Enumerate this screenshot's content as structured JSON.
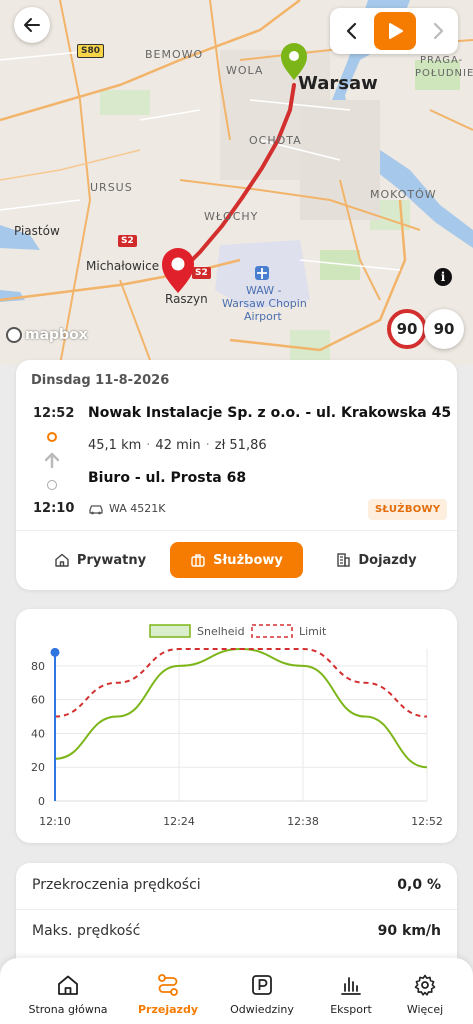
{
  "map": {
    "labels": {
      "bemowo": "BEMOWO",
      "wola": "WOLA",
      "warsaw": "Warsaw",
      "praga": "PRAGA-",
      "poludnie": "POŁUDNIE",
      "ochota": "OCHOTA",
      "ursus": "URSUS",
      "mokotow": "MOKOTÓW",
      "piastow": "Piastów",
      "wlochy": "WŁOCHY",
      "michalowice": "Michałowice",
      "raszyn": "Raszyn",
      "airport_1": "WAW -",
      "airport_2": "Warsaw Chopin",
      "airport_3": "Airport",
      "road_s80": "S80",
      "road_s2a": "S2",
      "road_s2b": "S2"
    },
    "attribution": "mapbox",
    "speed_limit": "90",
    "current_speed": "90",
    "colors": {
      "route": "#d32f2f",
      "start_pin": "#7cb518",
      "end_pin": "#e0212b",
      "accent": "#f57c00"
    }
  },
  "trip": {
    "date": "Dinsdag 11-8-2026",
    "start_time": "12:52",
    "start_address": "Nowak Instalacje Sp. z o.o. - ul. Krakowska 45",
    "distance": "45,1 km",
    "duration": "42 min",
    "cost": "zł 51,86",
    "end_address": "Biuro - ul. Prosta 68",
    "end_time": "12:10",
    "vehicle": "WA 4521K",
    "badge": "SŁUŻBOWY",
    "categories": [
      {
        "label": "Prywatny",
        "icon": "home-icon"
      },
      {
        "label": "Służbowy",
        "icon": "briefcase-icon"
      },
      {
        "label": "Dojazdy",
        "icon": "building-icon"
      }
    ],
    "active_category": "Służbowy"
  },
  "chart_data": {
    "type": "line",
    "x": [
      "12:10",
      "12:17",
      "12:24",
      "12:31",
      "12:38",
      "12:45",
      "12:52"
    ],
    "xticks": [
      "12:10",
      "12:24",
      "12:38",
      "12:52"
    ],
    "yticks": [
      "0",
      "20",
      "40",
      "60",
      "80"
    ],
    "ylim": [
      0,
      90
    ],
    "series": [
      {
        "name": "Snelheid",
        "values": [
          25,
          50,
          80,
          90,
          80,
          50,
          20
        ],
        "color": "#7cb518",
        "style": "solid"
      },
      {
        "name": "Limit",
        "values": [
          50,
          70,
          90,
          90,
          90,
          70,
          50
        ],
        "color": "#d32f2f",
        "style": "dashed"
      }
    ],
    "marker": {
      "x": "12:10",
      "y": 88
    },
    "legend_position": "top-center",
    "grid": true
  },
  "stats": {
    "speeding_label": "Przekroczenia prędkości",
    "speeding_value": "0,0 %",
    "max_speed_label": "Maks. prędkość",
    "max_speed_value": "90 km/h"
  },
  "nav": {
    "items": [
      {
        "label": "Strona główna",
        "icon": "home-icon"
      },
      {
        "label": "Przejazdy",
        "icon": "route-icon"
      },
      {
        "label": "Odwiedziny",
        "icon": "parking-icon"
      },
      {
        "label": "Eksport",
        "icon": "bar-chart-icon"
      },
      {
        "label": "Więcej",
        "icon": "gear-icon"
      }
    ],
    "active": "Przejazdy"
  }
}
